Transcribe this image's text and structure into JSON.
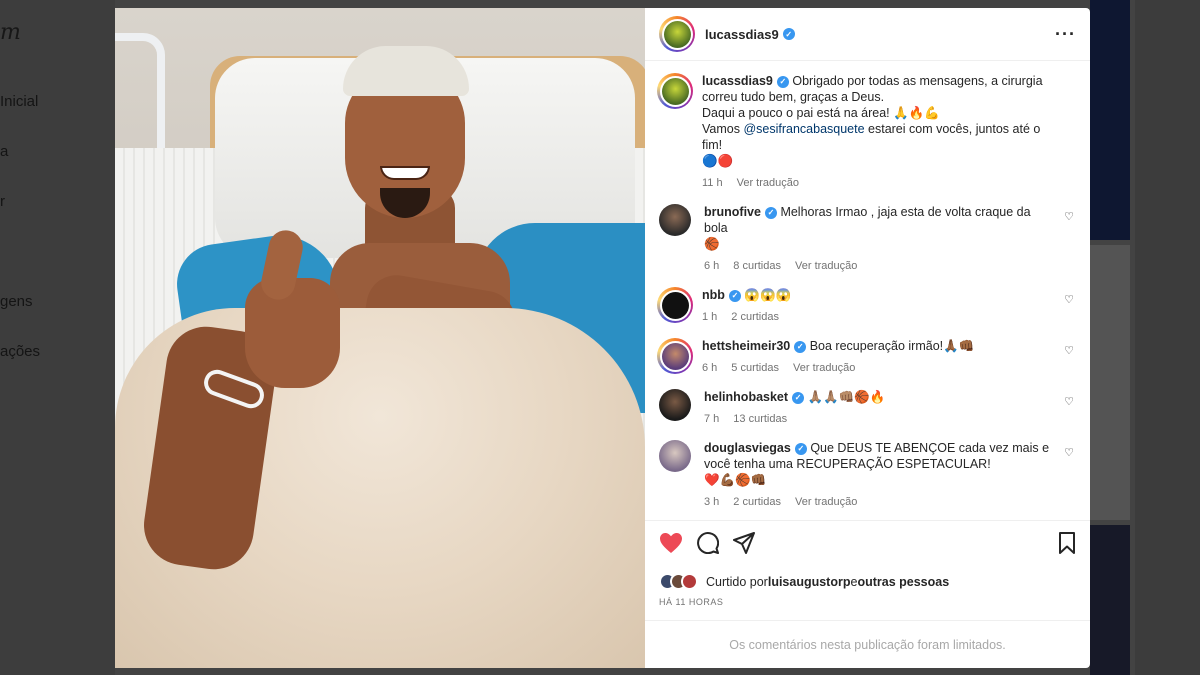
{
  "background": {
    "logo": "m",
    "nav": [
      "Inicial",
      "a",
      "r",
      "gens",
      "ações"
    ]
  },
  "post": {
    "author": "lucassdias9",
    "caption": {
      "username": "lucassdias9",
      "line1": "Obrigado por todas as mensagens, a cirurgia correu tudo bem, graças a Deus.",
      "line2": "Daqui a pouco o pai está na área! 🙏🔥💪",
      "line3_prefix": "Vamos ",
      "line3_mention": "@sesifrancabasquete",
      "line3_suffix": " estarei com vocês, juntos até o fim!",
      "line4": "🔵🔴",
      "time": "11 h",
      "translate": "Ver tradução"
    },
    "comments": [
      {
        "username": "brunofive",
        "text": "Melhoras Irmao , jaja esta de volta craque da bola",
        "extra": "🏀",
        "time": "6 h",
        "likes": "8 curtidas",
        "translate": "Ver tradução"
      },
      {
        "username": "nbb",
        "text": "😱😱😱",
        "extra": "",
        "time": "1 h",
        "likes": "2 curtidas",
        "translate": ""
      },
      {
        "username": "hettsheimeir30",
        "text": "Boa recuperação irmão!🙏🏾👊🏾",
        "extra": "",
        "time": "6 h",
        "likes": "5 curtidas",
        "translate": "Ver tradução"
      },
      {
        "username": "helinhobasket",
        "text": "🙏🏽🙏🏽👊🏽🏀🔥",
        "extra": "",
        "time": "7 h",
        "likes": "13 curtidas",
        "translate": ""
      },
      {
        "username": "douglasviegas",
        "text": "Que DEUS TE ABENÇOE cada vez mais e você tenha uma RECUPERAÇÃO ESPETACULAR!",
        "extra": "❤️💪🏾🏀👊🏾",
        "time": "3 h",
        "likes": "2 curtidas",
        "translate": "Ver tradução"
      }
    ],
    "liked_by_prefix": "Curtido por ",
    "liked_by_user": "luisaugustorp",
    "liked_by_and": " e ",
    "liked_by_others": "outras pessoas",
    "posted_ago": "HÁ 11 HORAS",
    "comments_limited": "Os comentários nesta publicação foram limitados."
  },
  "icons": {
    "like": "heart-icon",
    "comment": "comment-icon",
    "share": "share-icon",
    "save": "bookmark-icon",
    "more": "more-options-icon"
  },
  "colors": {
    "verified": "#3897f0",
    "like_active": "#ed4956",
    "link": "#00376b",
    "muted": "#737373"
  }
}
